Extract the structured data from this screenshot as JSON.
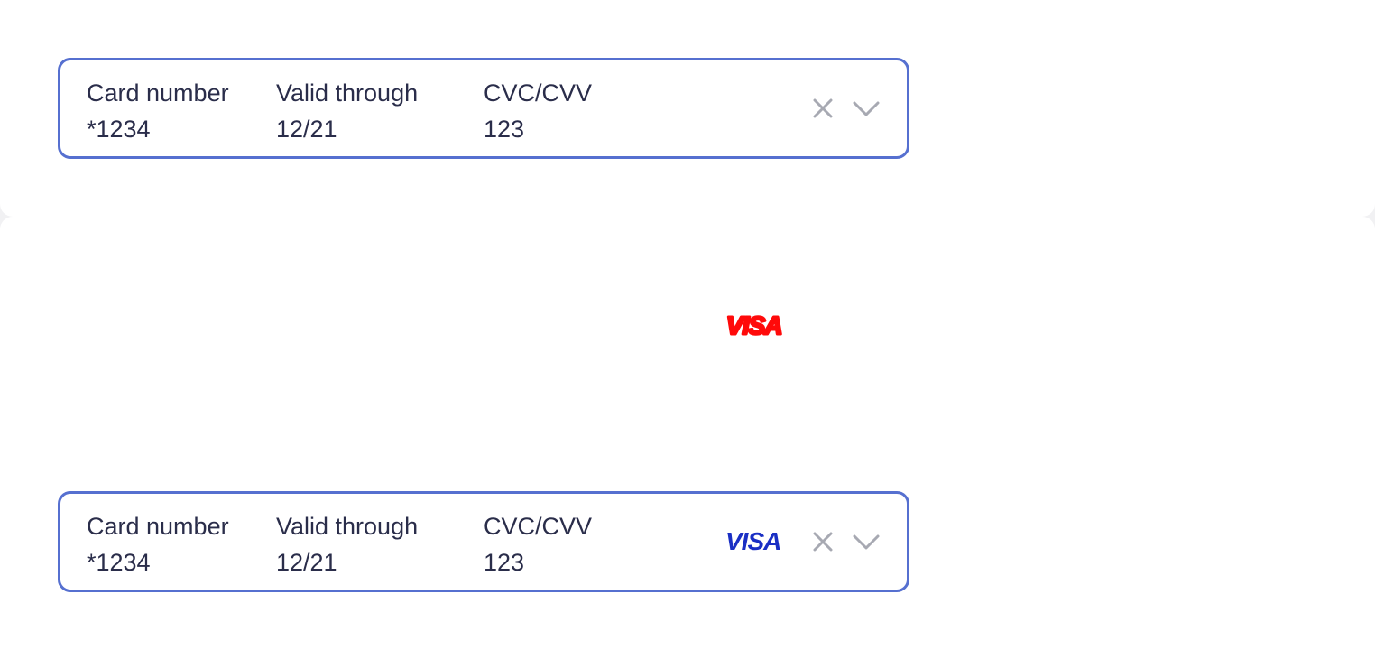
{
  "colors": {
    "field_border": "#5670d0",
    "text": "#2a2d4a",
    "icon": "#a7a9b2",
    "visa_blue": "#1a2fc4",
    "visa_red": "#ff0a0a"
  },
  "top_field": {
    "card_number_label": "Card number",
    "card_number_value": "*1234",
    "valid_label": "Valid through",
    "valid_value": "12/21",
    "cvc_label": "CVC/CVV",
    "cvc_value": "123",
    "clear_icon": "close-icon",
    "expand_icon": "chevron-down-icon"
  },
  "brand_sample": {
    "text": "VISA"
  },
  "bottom_field": {
    "card_number_label": "Card number",
    "card_number_value": "*1234",
    "valid_label": "Valid through",
    "valid_value": "12/21",
    "cvc_label": "CVC/CVV",
    "cvc_value": "123",
    "brand": "VISA",
    "clear_icon": "close-icon",
    "expand_icon": "chevron-down-icon"
  }
}
